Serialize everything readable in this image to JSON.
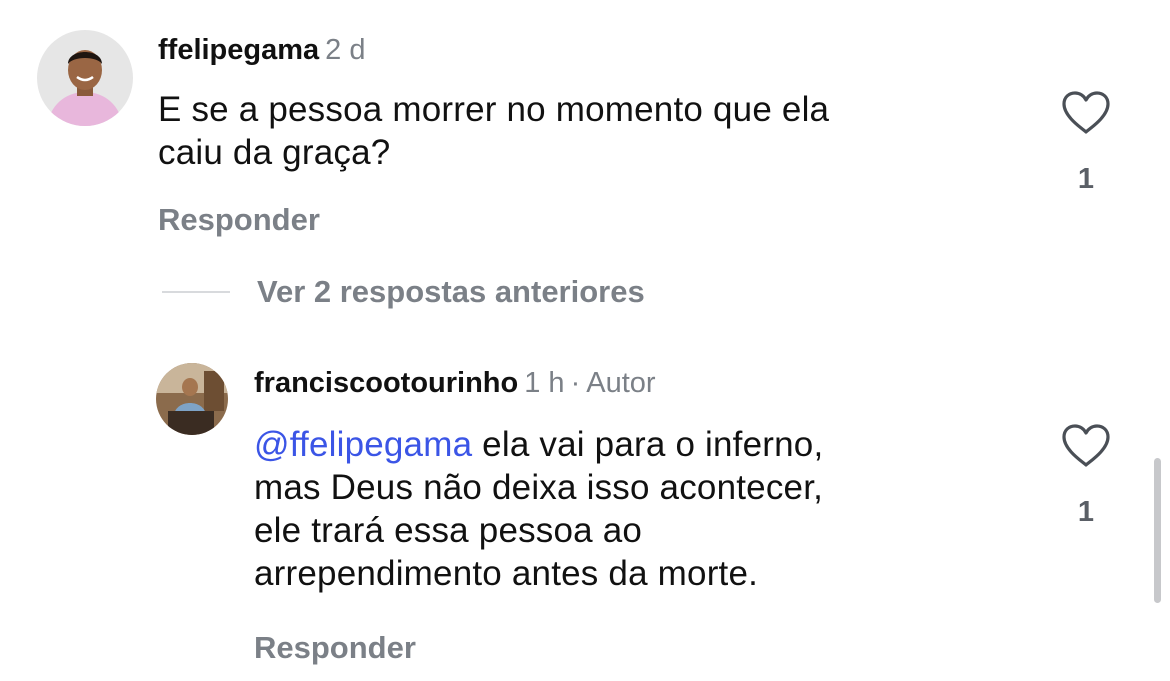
{
  "comment": {
    "username": "ffelipegama",
    "time": "2 d",
    "text_line1": "E se a pessoa morrer no momento que ela",
    "text_line2": "caiu da graça?",
    "reply_label": "Responder",
    "likes": "1",
    "avatar_icon": "profile-photo"
  },
  "thread": {
    "view_replies_label": "Ver 2 respostas anteriores"
  },
  "reply": {
    "username": "franciscootourinho",
    "time": "1 h",
    "separator": "·",
    "role": "Autor",
    "mention": "@ffelipegama",
    "text_line1": " ela vai para o inferno,",
    "text_line2": "mas Deus não deixa isso acontecer,",
    "text_line3": "ele trará essa pessoa ao",
    "text_line4": "arrependimento antes da morte.",
    "reply_label": "Responder",
    "likes": "1",
    "avatar_icon": "profile-photo"
  },
  "icons": {
    "like": "heart-outline-icon"
  },
  "colors": {
    "mention": "#3b55e6",
    "secondary_text": "#7b8087",
    "background": "#ffffff"
  }
}
